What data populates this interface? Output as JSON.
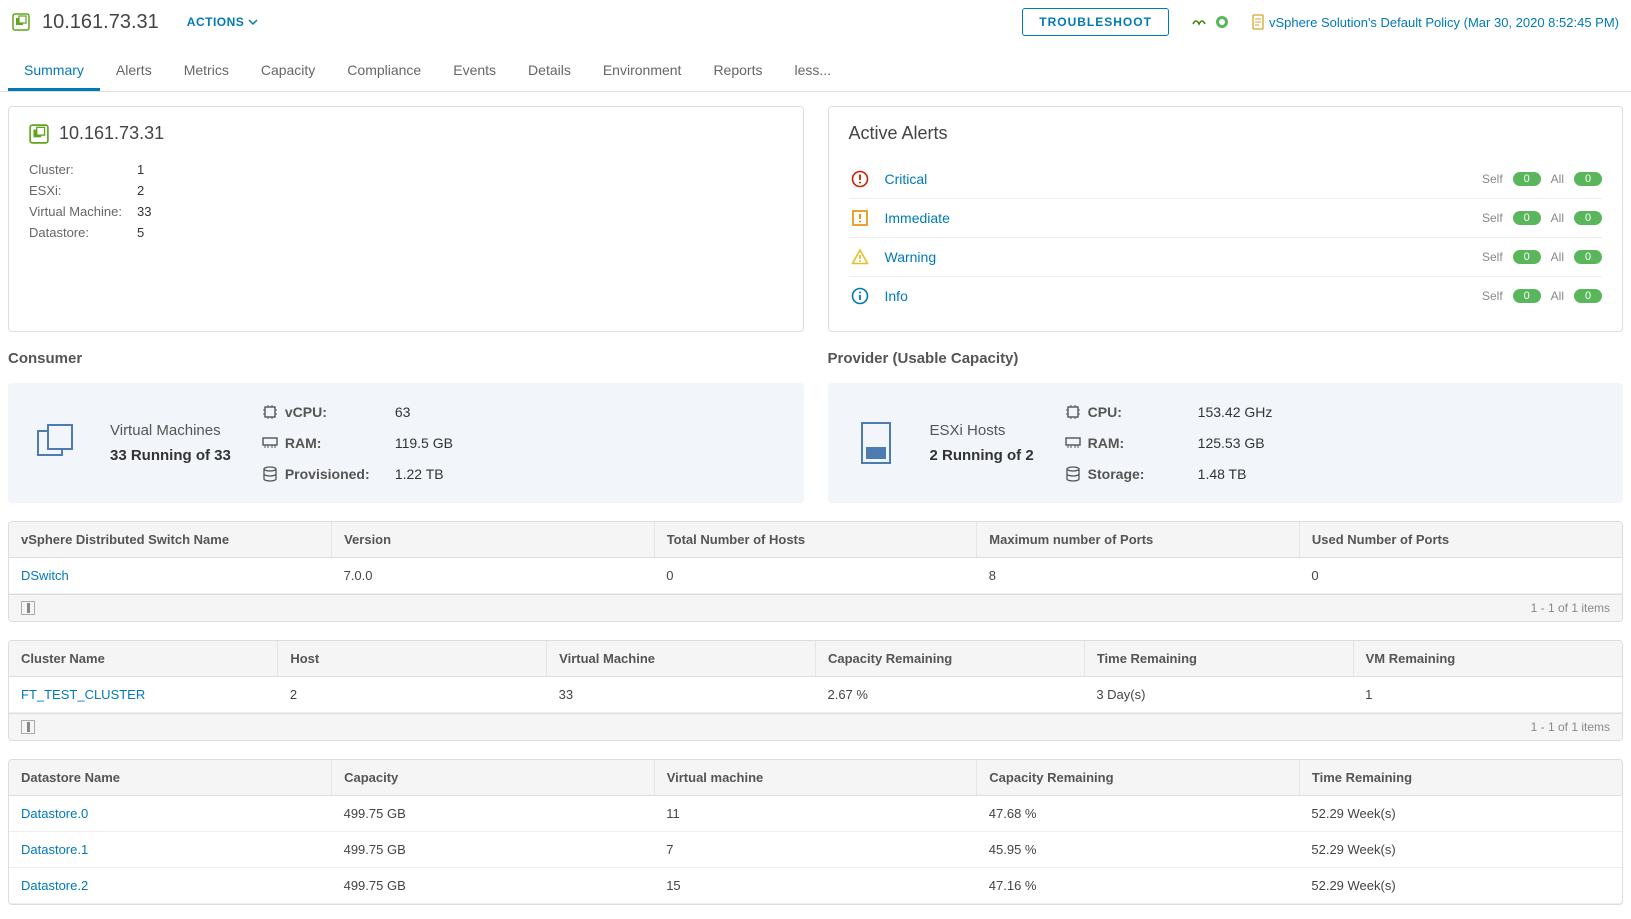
{
  "header": {
    "ip": "10.161.73.31",
    "actions_label": "ACTIONS",
    "troubleshoot_label": "TROUBLESHOOT",
    "policy_label": "vSphere Solution's Default Policy (Mar 30, 2020 8:52:45 PM)"
  },
  "tabs": [
    "Summary",
    "Alerts",
    "Metrics",
    "Capacity",
    "Compliance",
    "Events",
    "Details",
    "Environment",
    "Reports",
    "less..."
  ],
  "active_tab": "Summary",
  "summary": {
    "ip": "10.161.73.31",
    "props": [
      {
        "label": "Cluster:",
        "value": "1"
      },
      {
        "label": "ESXi:",
        "value": "2"
      },
      {
        "label": "Virtual Machine:",
        "value": "33"
      },
      {
        "label": "Datastore:",
        "value": "5"
      }
    ]
  },
  "alerts": {
    "title": "Active Alerts",
    "levels": [
      {
        "name": "Critical",
        "icon": "critical",
        "self": "0",
        "all": "0"
      },
      {
        "name": "Immediate",
        "icon": "immediate",
        "self": "0",
        "all": "0"
      },
      {
        "name": "Warning",
        "icon": "warning",
        "self": "0",
        "all": "0"
      },
      {
        "name": "Info",
        "icon": "info",
        "self": "0",
        "all": "0"
      }
    ],
    "self_label": "Self",
    "all_label": "All"
  },
  "consumer": {
    "title": "Consumer",
    "big_label1": "Virtual Machines",
    "big_label2": "33 Running of 33",
    "metrics": [
      {
        "icon": "cpu",
        "label": "vCPU:",
        "value": "63"
      },
      {
        "icon": "ram",
        "label": "RAM:",
        "value": "119.5 GB"
      },
      {
        "icon": "disk",
        "label": "Provisioned:",
        "value": "1.22 TB"
      }
    ]
  },
  "provider": {
    "title": "Provider (Usable Capacity)",
    "big_label1": "ESXi Hosts",
    "big_label2": "2 Running of 2",
    "metrics": [
      {
        "icon": "cpu",
        "label": "CPU:",
        "value": "153.42 GHz"
      },
      {
        "icon": "ram",
        "label": "RAM:",
        "value": "125.53 GB"
      },
      {
        "icon": "disk",
        "label": "Storage:",
        "value": "1.48 TB"
      }
    ]
  },
  "tables": {
    "switch": {
      "headers": [
        "vSphere Distributed Switch Name",
        "Version",
        "Total Number of Hosts",
        "Maximum number of Ports",
        "Used Number of Ports"
      ],
      "widths": [
        "20%",
        "20%",
        "20%",
        "20%",
        "20%"
      ],
      "rows": [
        [
          "DSwitch",
          "7.0.0",
          "0",
          "8",
          "0"
        ]
      ],
      "link_col": 0,
      "footer": "1 - 1 of 1 items"
    },
    "cluster": {
      "headers": [
        "Cluster Name",
        "Host",
        "Virtual Machine",
        "Capacity Remaining",
        "Time Remaining",
        "VM Remaining"
      ],
      "widths": [
        "16.6%",
        "16.6%",
        "16.6%",
        "16.6%",
        "16.6%",
        "16.6%"
      ],
      "rows": [
        [
          "FT_TEST_CLUSTER",
          "2",
          "33",
          "2.67 %",
          "3 Day(s)",
          "1"
        ]
      ],
      "link_col": 0,
      "footer": "1 - 1 of 1 items"
    },
    "datastore": {
      "headers": [
        "Datastore Name",
        "Capacity",
        "Virtual machine",
        "Capacity Remaining",
        "Time Remaining"
      ],
      "widths": [
        "20%",
        "20%",
        "20%",
        "20%",
        "20%"
      ],
      "rows": [
        [
          "Datastore.0",
          "499.75 GB",
          "11",
          "47.68 %",
          "52.29 Week(s)"
        ],
        [
          "Datastore.1",
          "499.75 GB",
          "7",
          "45.95 %",
          "52.29 Week(s)"
        ],
        [
          "Datastore.2",
          "499.75 GB",
          "15",
          "47.16 %",
          "52.29 Week(s)"
        ]
      ],
      "link_col": 0,
      "footer": null
    }
  }
}
